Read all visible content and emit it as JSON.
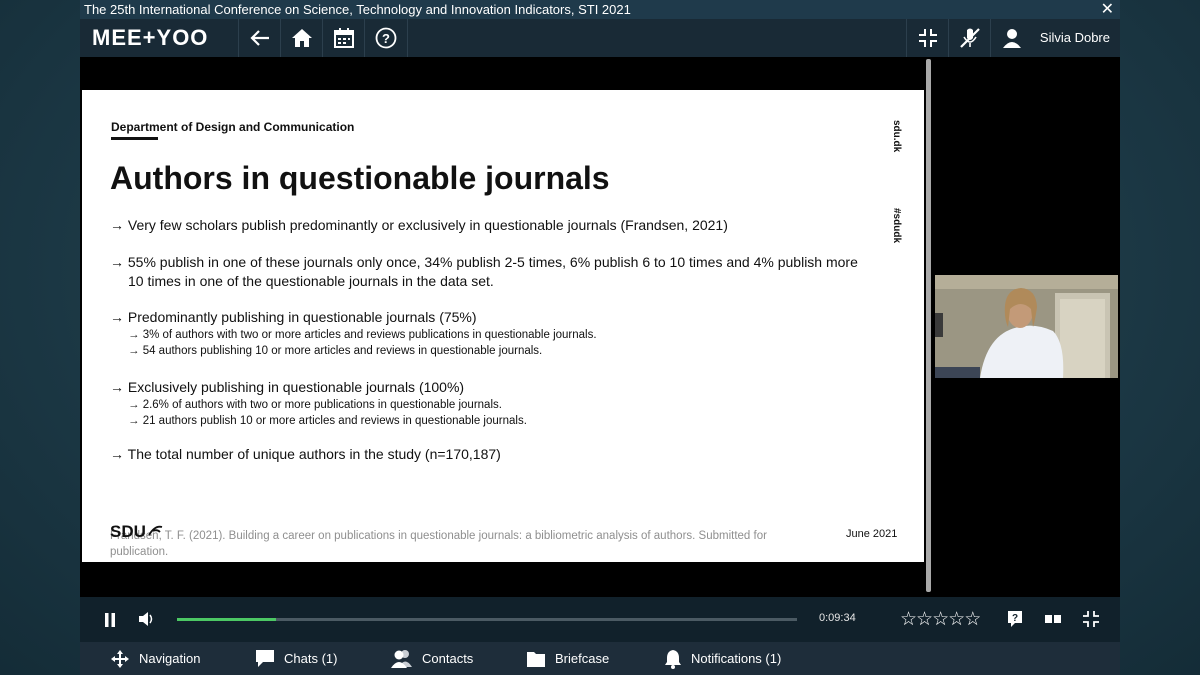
{
  "window": {
    "title": "The 25th International Conference on Science, Technology and Innovation Indicators, STI 2021",
    "close_glyph": "✕"
  },
  "header": {
    "logo": "MEE+YOO",
    "icons": [
      "back-arrow-icon",
      "home-icon",
      "calendar-icon",
      "help-icon",
      "fullscreen-exit-icon",
      "mic-off-icon",
      "user-icon"
    ],
    "user_name": "Silvia Dobre"
  },
  "slide": {
    "department": "Department of Design and Communication",
    "title": "Authors in questionable journals",
    "side_labels": [
      "sdu.dk",
      "#sdudk"
    ],
    "bullets": [
      {
        "text": "→ Very few scholars publish predominantly or exclusively in questionable journals (Frandsen, 2021)"
      },
      {
        "text": "→ 55% publish in one of these journals only once, 34% publish 2-5 times, 6% publish 6 to 10 times and 4% publish more",
        "text2": "10 times in one of the questionable journals in the data set."
      },
      {
        "text": "→ Predominantly publishing in questionable journals (75%)",
        "subs": [
          "→ 3% of authors with two or more articles and reviews publications in questionable journals.",
          "→ 54 authors publishing 10 or more articles and reviews in questionable journals."
        ]
      },
      {
        "text": "→ Exclusively publishing in questionable journals (100%)",
        "subs": [
          "→ 2.6% of authors with two or more publications in questionable journals.",
          "→ 21 authors publish 10 or more articles and reviews in questionable journals."
        ]
      },
      {
        "text": "→ The total number of unique authors in the study (n=170,187)"
      }
    ],
    "citation": "Frandsen, T. F. (2021). Building a career on publications in questionable journals: a bibliometric analysis of authors. Submitted for publication.",
    "logo": "SDU",
    "date": "June 2021"
  },
  "player": {
    "time": "0:09:34",
    "progress_percent": 16,
    "rating": {
      "stars": 5,
      "filled": 0
    },
    "icons": [
      "pause-icon",
      "volume-icon",
      "question-icon",
      "layout-icon",
      "exit-fullscreen-icon"
    ]
  },
  "bottom_nav": [
    {
      "label": "Navigation",
      "icon": "move-icon"
    },
    {
      "label": "Chats (1)",
      "icon": "chat-icon"
    },
    {
      "label": "Contacts",
      "icon": "contacts-icon"
    },
    {
      "label": "Briefcase",
      "icon": "folder-icon"
    },
    {
      "label": "Notifications (1)",
      "icon": "bell-icon"
    }
  ],
  "colors": {
    "accent_progress": "#4cc864",
    "header_bg": "#192a36",
    "nav_bg": "#1e2d3a"
  }
}
